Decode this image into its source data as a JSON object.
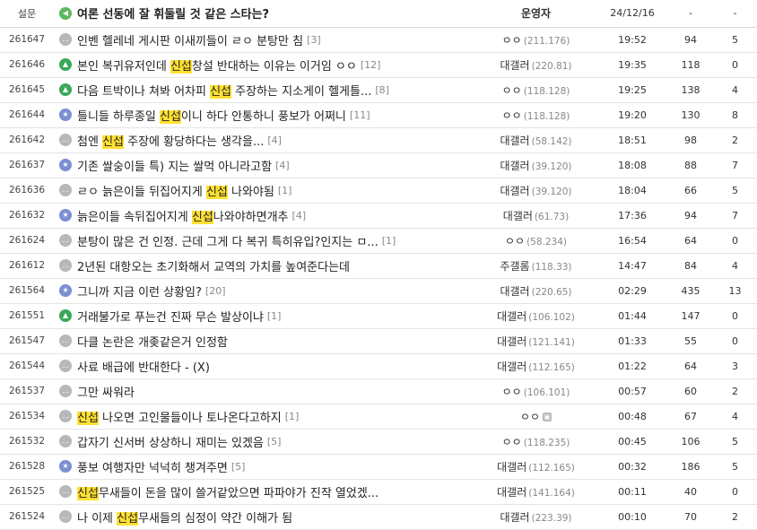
{
  "notice": {
    "label": "설문",
    "title": "여론 선동에 잘 휘둘릴 것 같은 스타는?",
    "writer": "운영자",
    "date": "24/12/16",
    "views": "-",
    "recommend": "-"
  },
  "rows": [
    {
      "num": "261647",
      "icon": "bubble",
      "parts": [
        {
          "t": "인벤 헬레네 게시판 이새끼들이 ㄹㅇ 분탕만 침"
        }
      ],
      "comments": "[3]",
      "nick": "ㅇㅇ",
      "ip": "(211.176)",
      "date": "19:52",
      "views": "94",
      "rec": "5"
    },
    {
      "num": "261646",
      "icon": "image",
      "parts": [
        {
          "t": "본인 복귀유저인데 "
        },
        {
          "t": "신섭",
          "h": true
        },
        {
          "t": "창설 반대하는 이유는 이거임 ㅇㅇ"
        }
      ],
      "comments": "[12]",
      "nick": "대갤러",
      "ip": "(220.81)",
      "date": "19:35",
      "views": "118",
      "rec": "0"
    },
    {
      "num": "261645",
      "icon": "image",
      "parts": [
        {
          "t": "다음 트박이나 쳐봐 어차피 "
        },
        {
          "t": "신섭",
          "h": true
        },
        {
          "t": " 주장하는 지소게이 헬게틀..."
        }
      ],
      "comments": "[8]",
      "nick": "ㅇㅇ",
      "ip": "(118.128)",
      "date": "19:25",
      "views": "138",
      "rec": "4"
    },
    {
      "num": "261644",
      "icon": "star",
      "parts": [
        {
          "t": "틀니들 하루종일 "
        },
        {
          "t": "신섭",
          "h": true
        },
        {
          "t": "이니 하다 안통하니 풍보가 어쩌니"
        }
      ],
      "comments": "[11]",
      "nick": "ㅇㅇ",
      "ip": "(118.128)",
      "date": "19:20",
      "views": "130",
      "rec": "8"
    },
    {
      "num": "261642",
      "icon": "bubble",
      "parts": [
        {
          "t": "첨엔 "
        },
        {
          "t": "신섭",
          "h": true
        },
        {
          "t": " 주장에 황당하다는 생각을..."
        }
      ],
      "comments": "[4]",
      "nick": "대갤러",
      "ip": "(58.142)",
      "date": "18:51",
      "views": "98",
      "rec": "2"
    },
    {
      "num": "261637",
      "icon": "star",
      "parts": [
        {
          "t": "기존 쌀숭이들 특) 지는 쌀먹 아니라고함"
        }
      ],
      "comments": "[4]",
      "nick": "대갤러",
      "ip": "(39.120)",
      "date": "18:08",
      "views": "88",
      "rec": "7"
    },
    {
      "num": "261636",
      "icon": "bubble",
      "parts": [
        {
          "t": "ㄹㅇ 늙은이들 뒤집어지게 "
        },
        {
          "t": "신섭",
          "h": true
        },
        {
          "t": " 나와야됨"
        }
      ],
      "comments": "[1]",
      "nick": "대갤러",
      "ip": "(39.120)",
      "date": "18:04",
      "views": "66",
      "rec": "5"
    },
    {
      "num": "261632",
      "icon": "star",
      "parts": [
        {
          "t": "늙은이들 속뒤집어지게 "
        },
        {
          "t": "신섭",
          "h": true
        },
        {
          "t": "나와야하면개추"
        }
      ],
      "comments": "[4]",
      "nick": "대갤러",
      "ip": "(61.73)",
      "date": "17:36",
      "views": "94",
      "rec": "7"
    },
    {
      "num": "261624",
      "icon": "bubble",
      "parts": [
        {
          "t": "분탕이 많은 건 인정. 근데 그게 다 복귀 특히유입?인지는 ㅁ..."
        }
      ],
      "comments": "[1]",
      "nick": "ㅇㅇ",
      "ip": "(58.234)",
      "date": "16:54",
      "views": "64",
      "rec": "0"
    },
    {
      "num": "261612",
      "icon": "bubble",
      "parts": [
        {
          "t": "2년된 대항오는 초기화해서 교역의 가치를 높여준다는데"
        }
      ],
      "comments": "",
      "nick": "주갤롬",
      "ip": "(118.33)",
      "date": "14:47",
      "views": "84",
      "rec": "4"
    },
    {
      "num": "261564",
      "icon": "star",
      "parts": [
        {
          "t": "그니까 지금 이런 상황임?"
        }
      ],
      "comments": "[20]",
      "nick": "대갤러",
      "ip": "(220.65)",
      "date": "02:29",
      "views": "435",
      "rec": "13"
    },
    {
      "num": "261551",
      "icon": "image",
      "parts": [
        {
          "t": "거래불가로 푸는건 진짜 무슨 발상이냐"
        }
      ],
      "comments": "[1]",
      "nick": "대갤러",
      "ip": "(106.102)",
      "date": "01:44",
      "views": "147",
      "rec": "0"
    },
    {
      "num": "261547",
      "icon": "bubble",
      "parts": [
        {
          "t": "다클 논란은 개좆같은거 인정함"
        }
      ],
      "comments": "",
      "nick": "대갤러",
      "ip": "(121.141)",
      "date": "01:33",
      "views": "55",
      "rec": "0"
    },
    {
      "num": "261544",
      "icon": "bubble",
      "parts": [
        {
          "t": "사료 배급에 반대한다 - (X)"
        }
      ],
      "comments": "",
      "nick": "대갤러",
      "ip": "(112.165)",
      "date": "01:22",
      "views": "64",
      "rec": "3"
    },
    {
      "num": "261537",
      "icon": "bubble",
      "parts": [
        {
          "t": "그만 싸워라"
        }
      ],
      "comments": "",
      "nick": "ㅇㅇ",
      "ip": "(106.101)",
      "date": "00:57",
      "views": "60",
      "rec": "2"
    },
    {
      "num": "261534",
      "icon": "bubble",
      "parts": [
        {
          "t": "신섭",
          "h": true
        },
        {
          "t": " 나오면 고인물들이나 토나온다고하지"
        }
      ],
      "comments": "[1]",
      "nick": "ㅇㅇ",
      "ip": "",
      "mark": true,
      "date": "00:48",
      "views": "67",
      "rec": "4"
    },
    {
      "num": "261532",
      "icon": "bubble",
      "parts": [
        {
          "t": "갑자기 신서버 상상하니 재미는 있겠음"
        }
      ],
      "comments": "[5]",
      "nick": "ㅇㅇ",
      "ip": "(118.235)",
      "date": "00:45",
      "views": "106",
      "rec": "5"
    },
    {
      "num": "261528",
      "icon": "star",
      "parts": [
        {
          "t": "풍보 여행자만 넉넉히 챙겨주면"
        }
      ],
      "comments": "[5]",
      "nick": "대갤러",
      "ip": "(112.165)",
      "date": "00:32",
      "views": "186",
      "rec": "5"
    },
    {
      "num": "261525",
      "icon": "bubble",
      "parts": [
        {
          "t": "신섭",
          "h": true
        },
        {
          "t": "무새들이 돈을 많이 쓸거같았으면 파파야가 진작 열었겠..."
        }
      ],
      "comments": "",
      "nick": "대갤러",
      "ip": "(141.164)",
      "date": "00:11",
      "views": "40",
      "rec": "0"
    },
    {
      "num": "261524",
      "icon": "bubble",
      "parts": [
        {
          "t": "나 이제 "
        },
        {
          "t": "신섭",
          "h": true
        },
        {
          "t": "무새들의 심정이 약간 이해가 됨"
        }
      ],
      "comments": "",
      "nick": "대갤러",
      "ip": "(223.39)",
      "date": "00:10",
      "views": "70",
      "rec": "2"
    }
  ]
}
